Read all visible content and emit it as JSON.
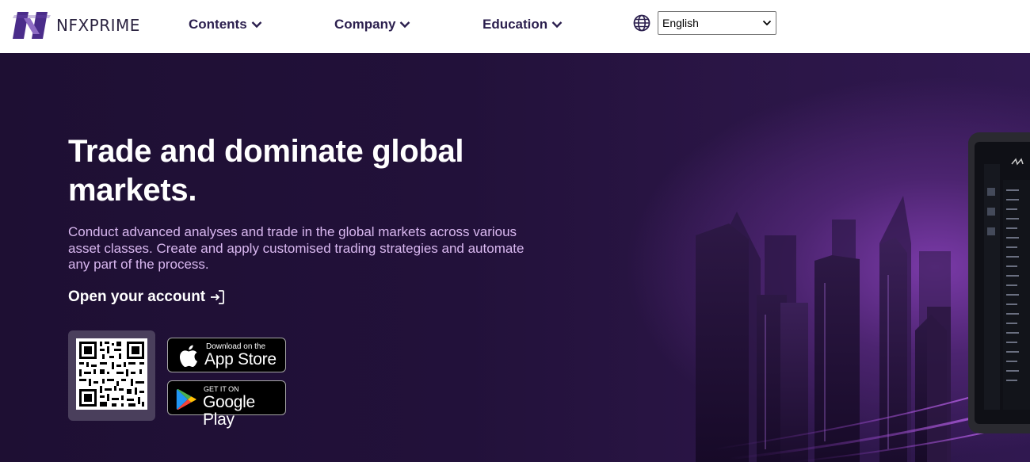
{
  "brand": {
    "name": "NFXPRIME"
  },
  "nav": {
    "items": [
      {
        "label": "Contents"
      },
      {
        "label": "Company"
      },
      {
        "label": "Education"
      }
    ]
  },
  "language": {
    "selected": "English"
  },
  "hero": {
    "title": "Trade and dominate global markets.",
    "subtitle": "Conduct advanced analyses and trade in the global markets across various asset classes. Create and apply customised trading strategies and automate any part of the process.",
    "cta_label": "Open your account"
  },
  "stores": {
    "app_store": {
      "small": "Download on the",
      "big": "App Store"
    },
    "google_play": {
      "small": "GET IT ON",
      "big": "Google Play"
    }
  },
  "icons": [
    "logo-icon",
    "chevron-down-icon",
    "globe-icon",
    "login-icon",
    "apple-icon",
    "google-play-icon",
    "qr-code"
  ],
  "colors": {
    "brand_purple": "#4a2c8a",
    "hero_text_accent": "#d9b8f0",
    "nav_text": "#2b1f4e"
  }
}
